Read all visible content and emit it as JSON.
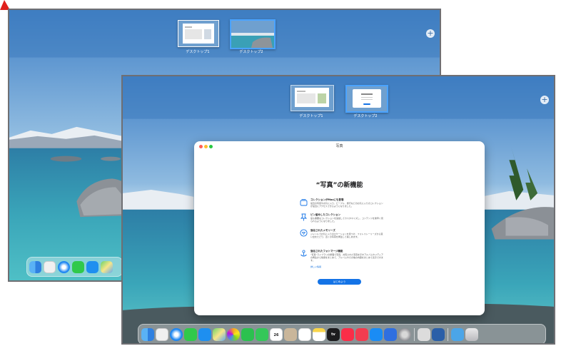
{
  "desktops": {
    "back": {
      "desktop1_label": "デスクトップ1",
      "desktop2_label": "デスクトップ2"
    },
    "front": {
      "desktop1_label": "デスクトップ1",
      "desktop2_label": "デスクトップ2"
    },
    "add_symbol": "+"
  },
  "photos_window": {
    "title": "写真",
    "heading": "“写真”の新機能",
    "features": [
      {
        "title": "コレクションがMacにも登場",
        "description": "最近の写真やお気に入り、ピープル、旅行などのお気に入りのコレクションが最近にアクセスできるようになりました。",
        "icon": "collections-icon"
      },
      {
        "title": "ピン留めしたコレクション",
        "description": "最も重要なコレクションを追加してカスタマイズし、コンテンツを素早く見られるようになりました。",
        "icon": "pin-icon"
      },
      {
        "title": "強化されたメモリーズ",
        "description": "ジャンルでお気に入りのロケーションを見つけ、フォトストーリーズから思い出をたどり、近くの写真を再生して楽しめます。",
        "icon": "memories-icon"
      },
      {
        "title": "強化されたフォトマージ機能",
        "description": "“写真”ライブラリの整理で写真、共有された写真を示すアルバムやメディアの再生から情報をまとめて、アルバムやその他の内容をまとめて表示できます。",
        "icon": "photo-share-icon",
        "link": "詳しい情報"
      }
    ],
    "start_button": "はじめよう"
  },
  "dock": {
    "back_apps": [
      "finder-icon",
      "launchpad-icon",
      "safari-icon",
      "messages-icon",
      "mail-icon",
      "maps-icon"
    ],
    "front_apps": [
      "finder-icon",
      "launchpad-icon",
      "safari-icon",
      "messages-icon",
      "mail-icon",
      "maps-icon",
      "photos-icon",
      "facetime-icon",
      "phone-icon",
      "calendar-icon",
      "contacts-icon",
      "reminders-icon",
      "notes-icon",
      "tv-icon",
      "music-icon",
      "news-icon",
      "appstore-icon",
      "keynote-icon",
      "system-settings-icon",
      "screenshot-icon",
      "preview-icon",
      "downloads-folder-icon",
      "trash-icon"
    ],
    "calendar_day": "26",
    "tv_label": "tv"
  },
  "colors": {
    "accent": "#1473e6",
    "cursor": "#e0201c",
    "close": "#ff5f57",
    "minimize": "#febc2e",
    "zoom": "#28c840"
  }
}
